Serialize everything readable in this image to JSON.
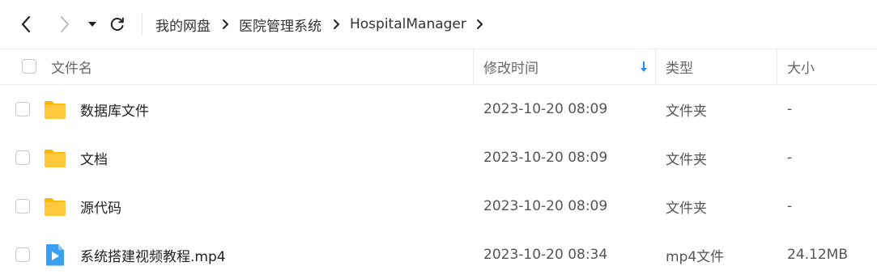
{
  "toolbar": {
    "back_icon": "chevron-left-icon",
    "forward_icon": "chevron-right-icon",
    "history_icon": "caret-down-icon",
    "refresh_icon": "refresh-icon"
  },
  "breadcrumb": [
    "我的网盘",
    "医院管理系统",
    "HospitalManager"
  ],
  "columns": {
    "name": "文件名",
    "modified": "修改时间",
    "type": "类型",
    "size": "大小"
  },
  "files": [
    {
      "name": "数据库文件",
      "modified": "2023-10-20 08:09",
      "type": "文件夹",
      "size": "-",
      "icon": "folder-icon"
    },
    {
      "name": "文档",
      "modified": "2023-10-20 08:09",
      "type": "文件夹",
      "size": "-",
      "icon": "folder-icon"
    },
    {
      "name": "源代码",
      "modified": "2023-10-20 08:09",
      "type": "文件夹",
      "size": "-",
      "icon": "folder-icon"
    },
    {
      "name": "系统搭建视频教程.mp4",
      "modified": "2023-10-20 08:34",
      "type": "mp4文件",
      "size": "24.12MB",
      "icon": "video-file-icon"
    }
  ],
  "colors": {
    "folder": "#FFC83D",
    "video": "#3AA0F2",
    "sort_arrow": "#2F8CF0"
  }
}
